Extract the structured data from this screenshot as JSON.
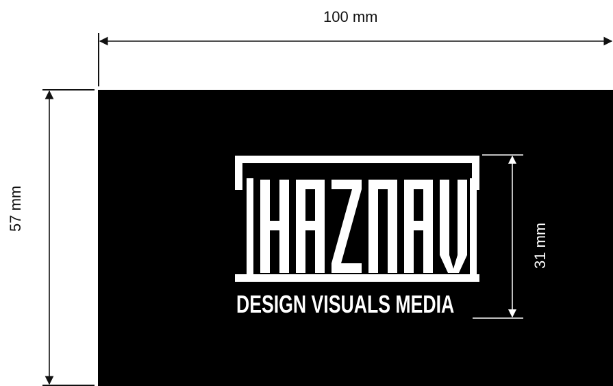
{
  "dimensions": {
    "width_label": "100 mm",
    "height_label": "57 mm",
    "logo_height_label": "31 mm"
  },
  "card": {
    "background": "#000000",
    "logo": {
      "wordmark": "HAZNAVI",
      "tagline": "DESIGN VISUALS MEDIA",
      "color": "#ffffff"
    }
  }
}
